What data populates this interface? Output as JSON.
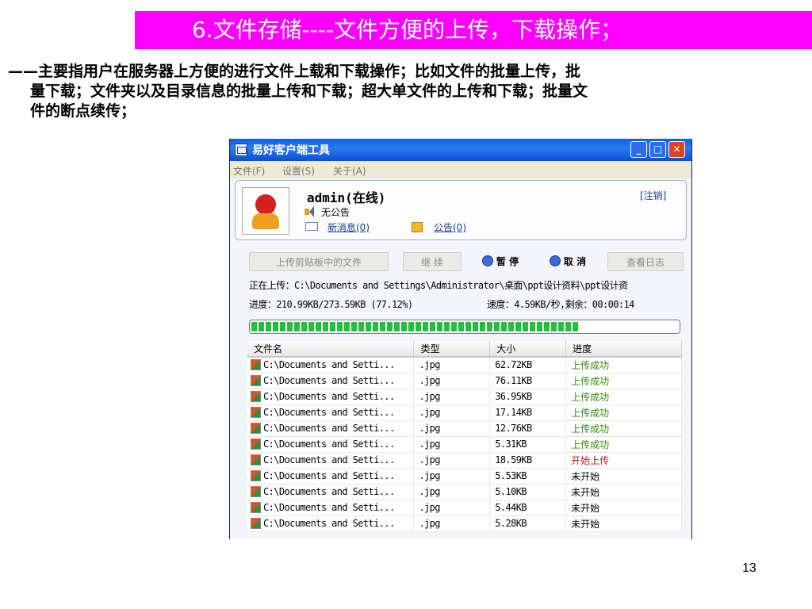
{
  "slide": {
    "title": "6.文件存储----文件方便的上传，下载操作；",
    "desc_line1": "——主要指用户在服务器上方便的进行文件上载和下载操作；比如文件的批量上传，批",
    "desc_line2": "量下载；文件夹以及目录信息的批量上传和下载；超大单文件的上传和下载；批量文",
    "desc_line3": "件的断点续传；",
    "page_number": "13",
    "banner_color": "#ff00ff"
  },
  "window": {
    "title": "易好客户端工具",
    "controls": {
      "minimize": "_",
      "maximize": "□",
      "close": "✕"
    },
    "menu": [
      "文件(F)",
      "设置(S)",
      "关于(A)"
    ]
  },
  "user": {
    "name": "admin(在线)",
    "logout": "[注销]",
    "notice": "无公告",
    "messages": "新消息(0)",
    "bulletins": "公告(0)"
  },
  "actions": {
    "upload_clipboard": "上传剪贴板中的文件",
    "resume": "继 续",
    "pause": "暂 停",
    "cancel": "取 消",
    "view_log": "查看日志"
  },
  "transfer": {
    "uploading": "正在上传：C:\\Documents and Settings\\Administrator\\桌面\\ppt设计资料\\ppt设计资",
    "progress_text": "进度：210.99KB/273.59KB (77.12%)",
    "speed_text": "速度：4.59KB/秒,剩余：00:00:14",
    "progress_fraction": 0.77
  },
  "table": {
    "headers": [
      "文件名",
      "类型",
      "大小",
      "进度"
    ],
    "rows": [
      {
        "name": "C:\\Documents and Setti...",
        "type": ".jpg",
        "size": "62.72KB",
        "status": "上传成功",
        "state": "ok"
      },
      {
        "name": "C:\\Documents and Setti...",
        "type": ".jpg",
        "size": "76.11KB",
        "status": "上传成功",
        "state": "ok"
      },
      {
        "name": "C:\\Documents and Setti...",
        "type": ".jpg",
        "size": "36.95KB",
        "status": "上传成功",
        "state": "ok"
      },
      {
        "name": "C:\\Documents and Setti...",
        "type": ".jpg",
        "size": "17.14KB",
        "status": "上传成功",
        "state": "ok"
      },
      {
        "name": "C:\\Documents and Setti...",
        "type": ".jpg",
        "size": "12.76KB",
        "status": "上传成功",
        "state": "ok"
      },
      {
        "name": "C:\\Documents and Setti...",
        "type": ".jpg",
        "size": "5.31KB",
        "status": "上传成功",
        "state": "ok"
      },
      {
        "name": "C:\\Documents and Setti...",
        "type": ".jpg",
        "size": "18.59KB",
        "status": "开始上传",
        "state": "start"
      },
      {
        "name": "C:\\Documents and Setti...",
        "type": ".jpg",
        "size": "5.53KB",
        "status": "未开始",
        "state": "wait"
      },
      {
        "name": "C:\\Documents and Setti...",
        "type": ".jpg",
        "size": "5.10KB",
        "status": "未开始",
        "state": "wait"
      },
      {
        "name": "C:\\Documents and Setti...",
        "type": ".jpg",
        "size": "5.44KB",
        "status": "未开始",
        "state": "wait"
      },
      {
        "name": "C:\\Documents and Setti...",
        "type": ".jpg",
        "size": "5.28KB",
        "status": "未开始",
        "state": "wait"
      }
    ]
  }
}
